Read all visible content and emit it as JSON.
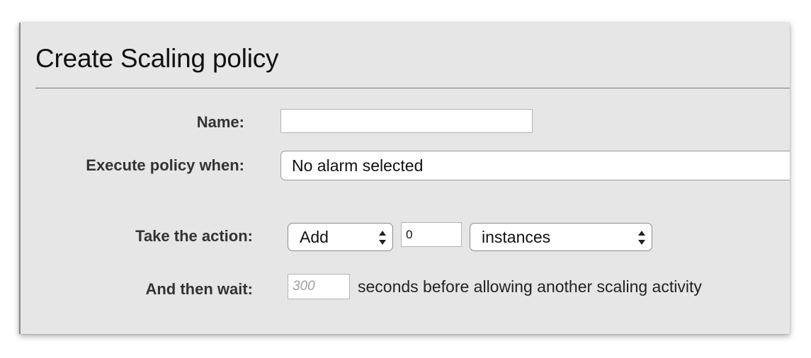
{
  "dialog": {
    "title": "Create Scaling policy"
  },
  "form": {
    "name": {
      "label": "Name:",
      "value": ""
    },
    "execute_when": {
      "label": "Execute policy when:",
      "selected": "No alarm selected"
    },
    "action": {
      "label": "Take the action:",
      "operation_selected": "Add",
      "count_value": "0",
      "unit_selected": "instances"
    },
    "wait": {
      "label": "And then wait:",
      "placeholder": "300",
      "suffix": "seconds before allowing another scaling activity"
    }
  },
  "icons": {
    "select_arrows": "up-down-chevron-icon"
  },
  "colors": {
    "panel_background": "#e6e6e6",
    "input_background": "#ffffff",
    "label_text": "#333333"
  }
}
